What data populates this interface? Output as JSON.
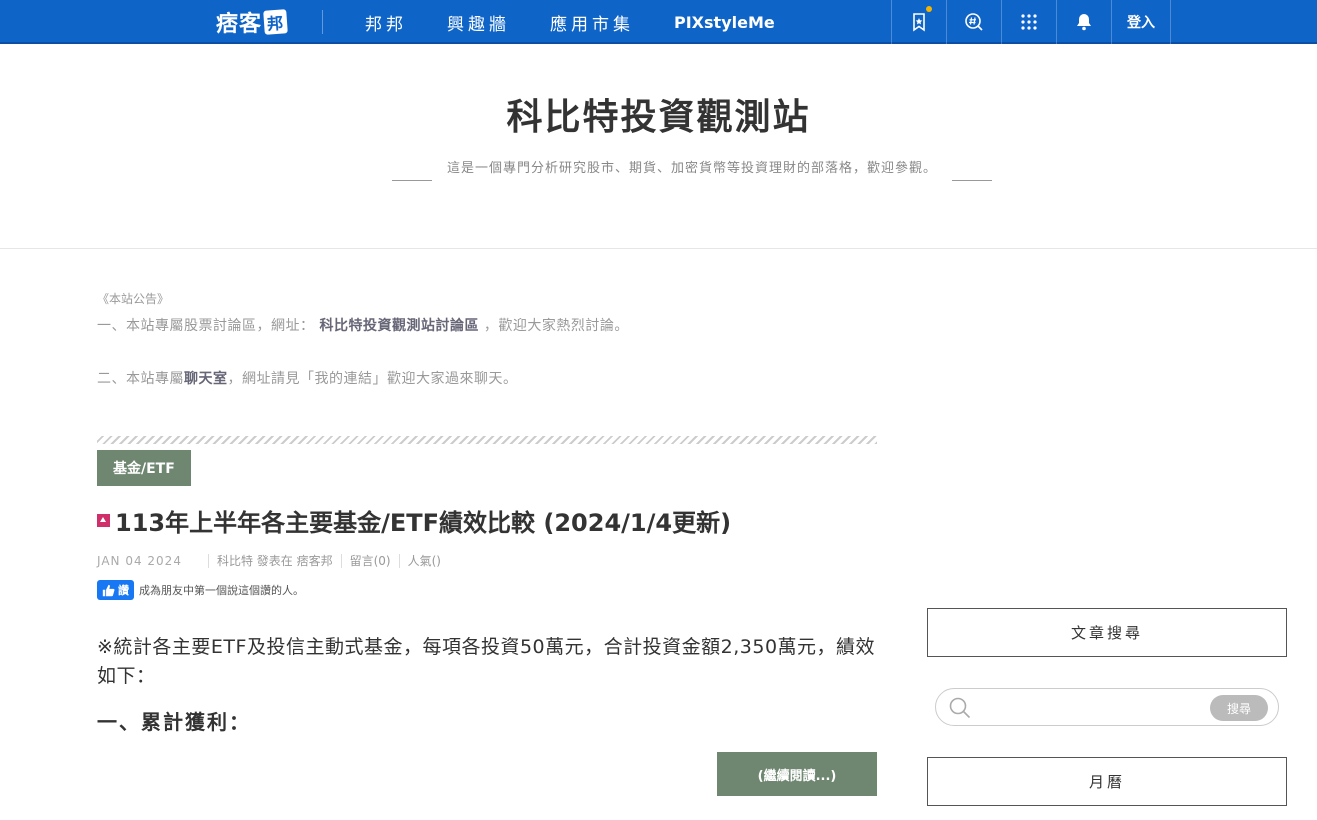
{
  "nav": {
    "logo_text": "痞客",
    "logo_mark": "邦",
    "links": [
      "邦邦",
      "興趣牆",
      "應用市集",
      "PIXstyleMe"
    ],
    "login_label": "登入"
  },
  "header": {
    "title": "科比特投資觀測站",
    "description": "這是一個專門分析研究股市、期貨、加密貨幣等投資理財的部落格，歡迎參觀。"
  },
  "announcement": {
    "title": "《本站公告》",
    "line1_prefix": "一、本站專屬股票討論區，網址：",
    "line1_link": "科比特投資觀測站討論區",
    "line1_suffix": "，歡迎大家熱烈討論。",
    "line2_prefix": "二、本站專屬",
    "line2_link": "聊天室",
    "line2_suffix": "，網址請見「我的連結」歡迎大家過來聊天。"
  },
  "post": {
    "category": "基金/ETF",
    "title": "113年上半年各主要基金/ETF績效比較 (2024/1/4更新)",
    "date": "JAN 04 2024",
    "author": "科比特 發表在 痞客邦",
    "comments": "留言(0)",
    "popularity": "人氣()",
    "like_label": "讚",
    "like_text": "成為朋友中第一個說這個讚的人。",
    "body": "※統計各主要ETF及投信主動式基金，每項各投資50萬元，合計投資金額2,350萬元，績效如下：",
    "heading": "一、累計獲利：",
    "more_label": "(繼續閱讀...)"
  },
  "sidebar": {
    "search_title": "文章搜尋",
    "search_placeholder": "",
    "search_button": "搜尋",
    "calendar_title": "月曆"
  },
  "colors": {
    "nav_blue": "#0f64c8",
    "accent_green": "#6f8771",
    "facebook_blue": "#1877f2"
  }
}
